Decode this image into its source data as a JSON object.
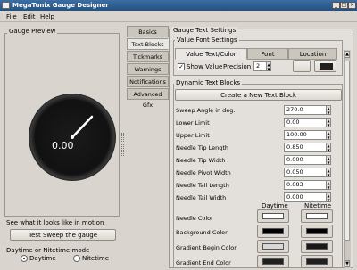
{
  "window": {
    "title": "MegaTunix Gauge Designer"
  },
  "menu": {
    "file": "File",
    "edit": "Edit",
    "help": "Help"
  },
  "preview": {
    "title": "Gauge Preview",
    "gauge_value": "0.00",
    "motion_label": "See what it looks like in motion",
    "test_button": "Test Sweep the gauge",
    "mode_label": "Daytime or Nitetime mode",
    "daytime": "Daytime",
    "nitetime": "Nitetime"
  },
  "tabs": [
    "Basics",
    "Text Blocks",
    "Tickmarks",
    "Warnings",
    "Notifications",
    "Advanced Gfx"
  ],
  "settings": {
    "title": "Gauge Text Settings",
    "value_font_title": "Value Font Settings",
    "subtabs": [
      "Value Text/Color",
      "Font",
      "Location"
    ],
    "show_value": "Show Value",
    "precision": "Precision",
    "precision_value": "2",
    "dynamic_title": "Dynamic Text Blocks",
    "create_button": "Create a New Text Block",
    "rows": [
      {
        "label": "Sweep Angle in deg.",
        "value": "270.0"
      },
      {
        "label": "Lower Limit",
        "value": "0.00"
      },
      {
        "label": "Upper Limit",
        "value": "100.00"
      },
      {
        "label": "Needle Tip Length",
        "value": "0.850"
      },
      {
        "label": "Needle Tip Width",
        "value": "0.000"
      },
      {
        "label": "Needle Pivot Width",
        "value": "0.050"
      },
      {
        "label": "Needle Tail Length",
        "value": "0.083"
      },
      {
        "label": "Needle Tail Width",
        "value": "0.000"
      }
    ],
    "color_headers": {
      "day": "Daytime",
      "night": "Nitetime"
    },
    "colors": [
      {
        "label": "Needle Color",
        "day": "#ffffff",
        "night": "#ffffff"
      },
      {
        "label": "Background Color",
        "day": "#000000",
        "night": "#000000"
      },
      {
        "label": "Gradient Begin Color",
        "day": "#d8d8d8",
        "night": "#1a1a1a"
      },
      {
        "label": "Gradient End Color",
        "day": "#202020",
        "night": "#202020"
      }
    ]
  }
}
